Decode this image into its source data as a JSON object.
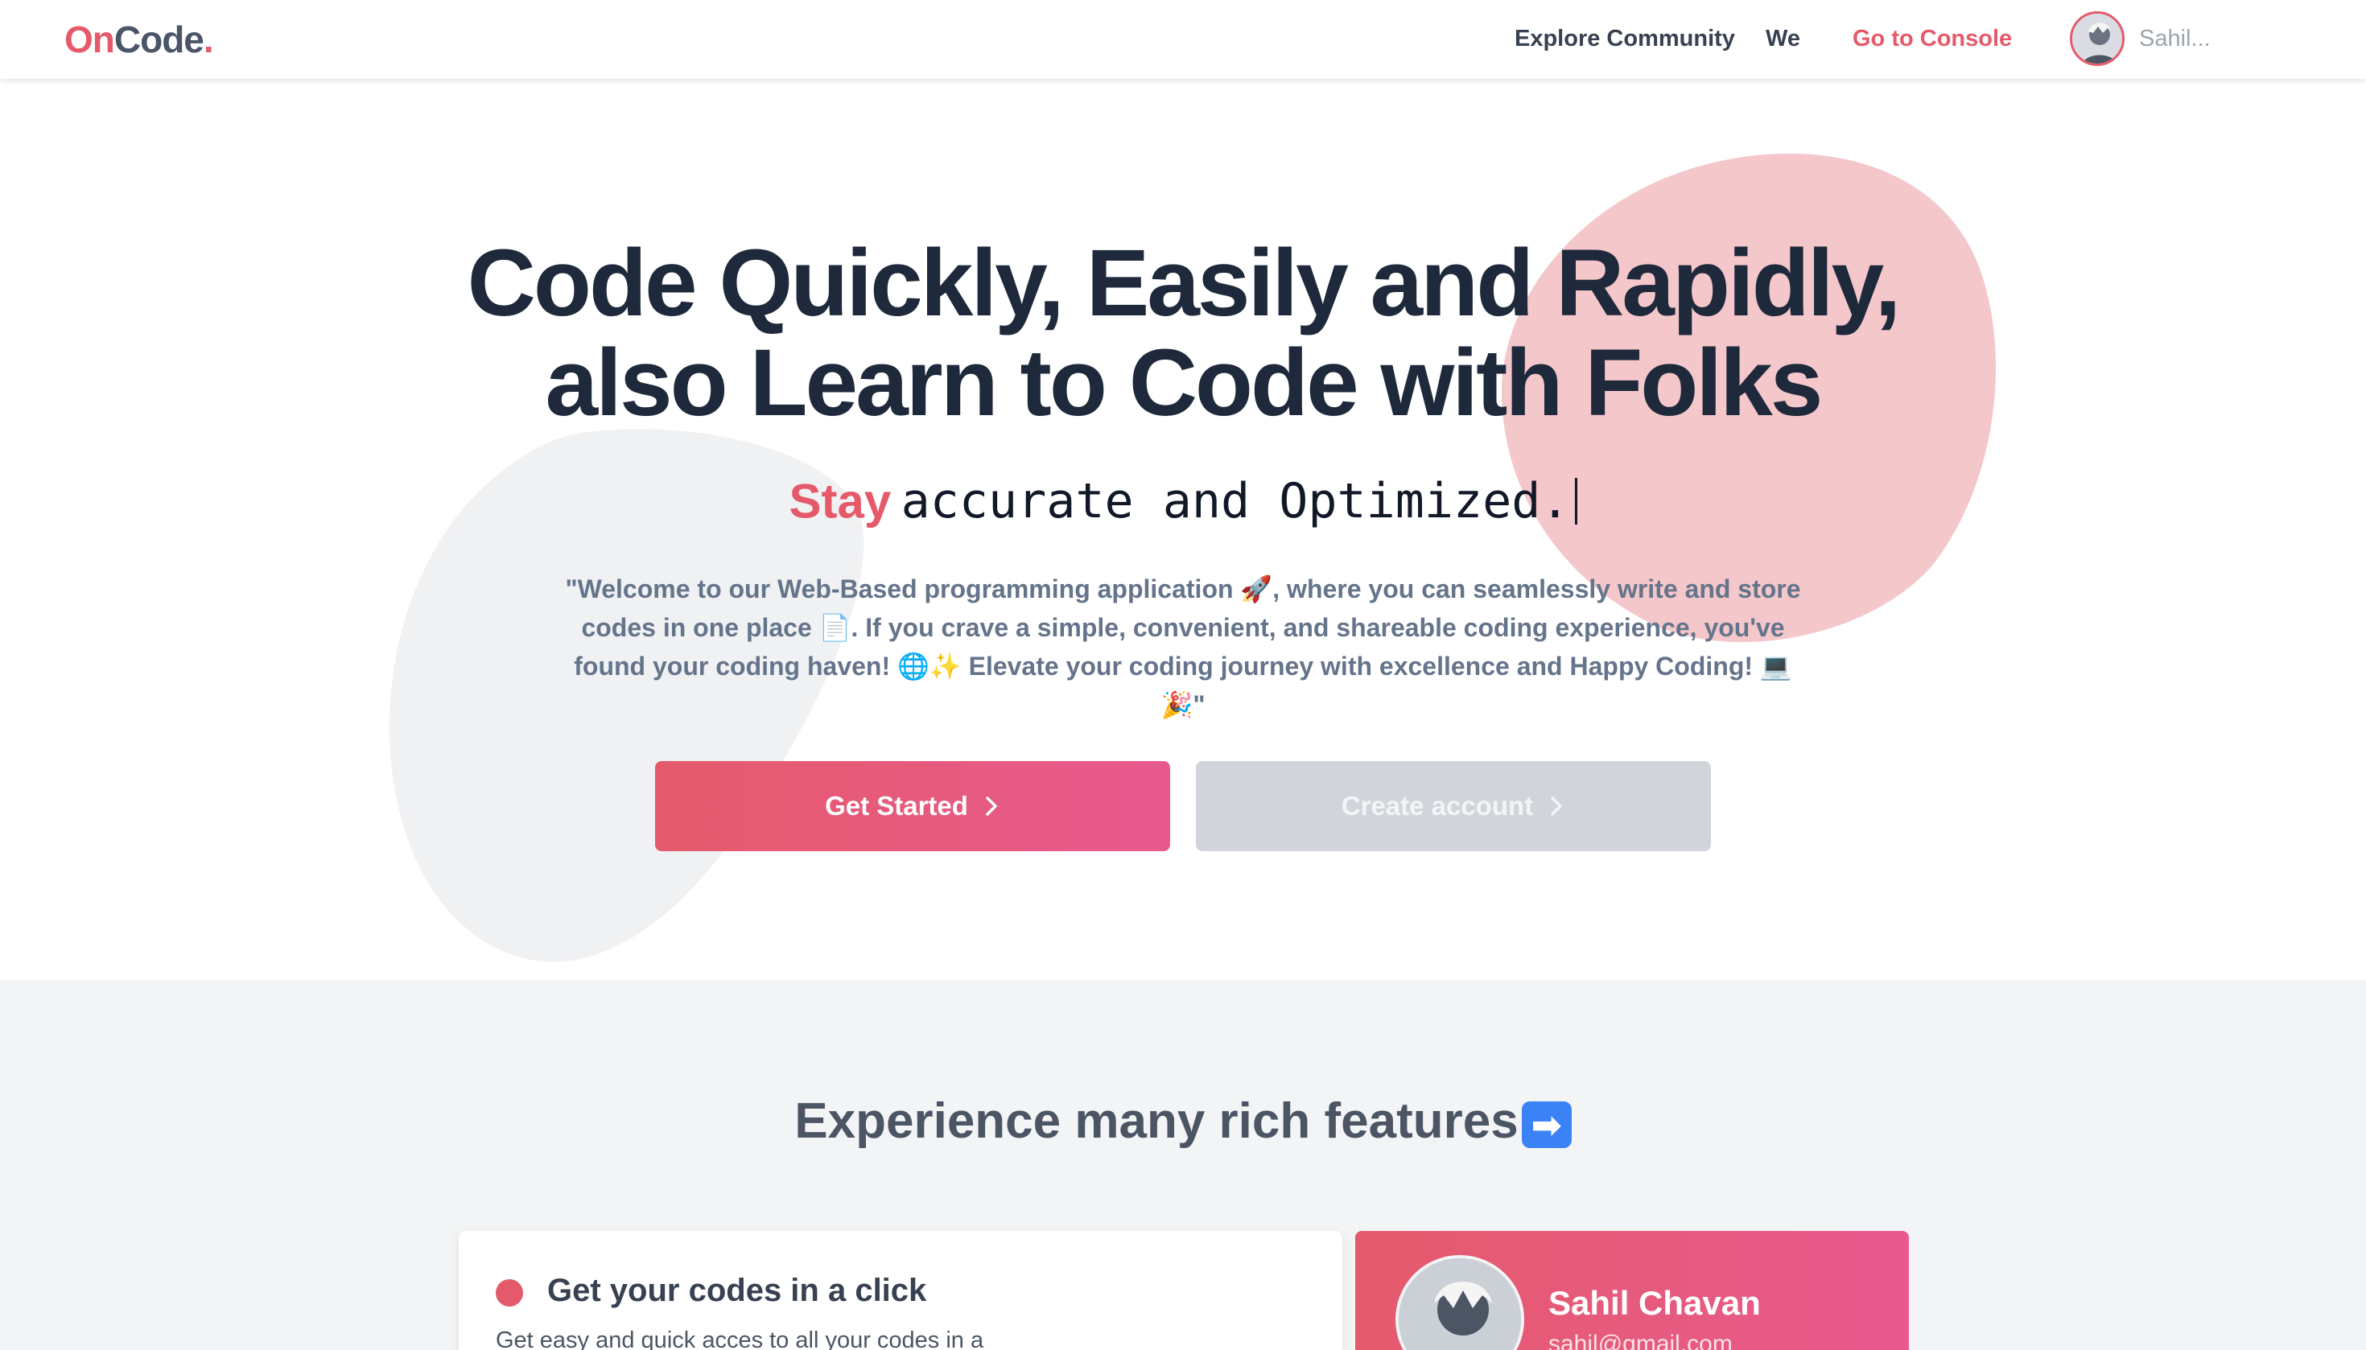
{
  "navbar": {
    "logo_on": "On",
    "logo_code": "Code",
    "logo_dot": ".",
    "links": [
      {
        "label": "Explore Community"
      },
      {
        "label": "We"
      },
      {
        "label": "Go to Console"
      }
    ],
    "user_name": "Sahil..."
  },
  "hero": {
    "title_line1": "Code Quickly, Easily and Rapidly,",
    "title_line2": "also Learn to Code with Folks",
    "typing_prefix": "Stay",
    "typing_text": "accurate and Optimized.",
    "description": "\"Welcome to our Web-Based programming application 🚀, where you can seamlessly write and store codes in one place 📄. If you crave a simple, convenient, and shareable coding experience, you've found your coding haven! 🌐✨ Elevate your coding journey with excellence and Happy Coding! 💻🎉\"",
    "btn_primary": "Get Started",
    "btn_secondary": "Create account"
  },
  "features": {
    "title": "Experience many rich features",
    "title_emoji": "➡",
    "card": {
      "heading": "Get your codes in a click",
      "text": "Get easy and quick acces to all your codes in a"
    },
    "profile": {
      "name": "Sahil Chavan",
      "email": "sahil@gmail.com"
    }
  },
  "colors": {
    "accent": "#e55a6b",
    "gradient_end": "#e85a8f",
    "title": "#1e293b",
    "muted_text": "#64748b",
    "feature_bg": "#f3f4f6",
    "blob_pink": "#f4c7ca",
    "blob_gray": "#f0f1f3"
  }
}
